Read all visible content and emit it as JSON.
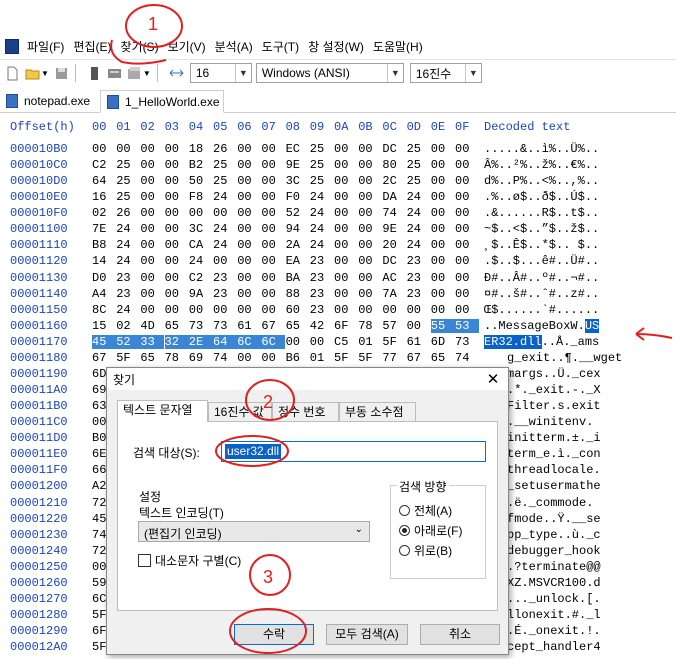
{
  "menu": [
    "파일(F)",
    "편집(E)",
    "찾기(S)",
    "보기(V)",
    "분석(A)",
    "도구(T)",
    "창 설정(W)",
    "도움말(H)"
  ],
  "toolbar": {
    "columns": "16",
    "encoding": "Windows (ANSI)",
    "base": "16진수"
  },
  "tabs": [
    "notepad.exe",
    "1_HelloWorld.exe"
  ],
  "hex_header": {
    "offset": "Offset(h)",
    "columns": [
      "00",
      "01",
      "02",
      "03",
      "04",
      "05",
      "06",
      "07",
      "08",
      "09",
      "0A",
      "0B",
      "0C",
      "0D",
      "0E",
      "0F"
    ],
    "decoded": "Decoded text"
  },
  "rows": [
    {
      "off": "000010B0",
      "bytes": [
        "00",
        "00",
        "00",
        "00",
        "18",
        "26",
        "00",
        "00",
        "EC",
        "25",
        "00",
        "00",
        "DC",
        "25",
        "00",
        "00"
      ],
      "text": ".....&..ì%..Ü%.."
    },
    {
      "off": "000010C0",
      "bytes": [
        "C2",
        "25",
        "00",
        "00",
        "B2",
        "25",
        "00",
        "00",
        "9E",
        "25",
        "00",
        "00",
        "80",
        "25",
        "00",
        "00"
      ],
      "text": "Â%..²%..ž%..€%.."
    },
    {
      "off": "000010D0",
      "bytes": [
        "64",
        "25",
        "00",
        "00",
        "50",
        "25",
        "00",
        "00",
        "3C",
        "25",
        "00",
        "00",
        "2C",
        "25",
        "00",
        "00"
      ],
      "text": "d%..P%..<%..,%.."
    },
    {
      "off": "000010E0",
      "bytes": [
        "16",
        "25",
        "00",
        "00",
        "F8",
        "24",
        "00",
        "00",
        "F0",
        "24",
        "00",
        "00",
        "DA",
        "24",
        "00",
        "00"
      ],
      "text": ".%..ø$..ð$..Ú$.."
    },
    {
      "off": "000010F0",
      "bytes": [
        "02",
        "26",
        "00",
        "00",
        "00",
        "00",
        "00",
        "00",
        "52",
        "24",
        "00",
        "00",
        "74",
        "24",
        "00",
        "00"
      ],
      "text": ".&......R$..t$.."
    },
    {
      "off": "00001100",
      "bytes": [
        "7E",
        "24",
        "00",
        "00",
        "3C",
        "24",
        "00",
        "00",
        "94",
        "24",
        "00",
        "00",
        "9E",
        "24",
        "00",
        "00"
      ],
      "text": "~$..<$..”$..ž$.."
    },
    {
      "off": "00001110",
      "bytes": [
        "B8",
        "24",
        "00",
        "00",
        "CA",
        "24",
        "00",
        "00",
        "2A",
        "24",
        "00",
        "00",
        "20",
        "24",
        "00",
        "00"
      ],
      "text": "¸$..Ê$..*$.. $.."
    },
    {
      "off": "00001120",
      "bytes": [
        "14",
        "24",
        "00",
        "00",
        "24",
        "00",
        "00",
        "00",
        "EA",
        "23",
        "00",
        "00",
        "DC",
        "23",
        "00",
        "00"
      ],
      "text": ".$..$...ê#..Ü#.."
    },
    {
      "off": "00001130",
      "bytes": [
        "D0",
        "23",
        "00",
        "00",
        "C2",
        "23",
        "00",
        "00",
        "BA",
        "23",
        "00",
        "00",
        "AC",
        "23",
        "00",
        "00"
      ],
      "text": "Ð#..Â#..º#..¬#.."
    },
    {
      "off": "00001140",
      "bytes": [
        "A4",
        "23",
        "00",
        "00",
        "9A",
        "23",
        "00",
        "00",
        "88",
        "23",
        "00",
        "00",
        "7A",
        "23",
        "00",
        "00"
      ],
      "text": "¤#..š#..ˆ#..z#.."
    },
    {
      "off": "00001150",
      "bytes": [
        "8C",
        "24",
        "00",
        "00",
        "00",
        "00",
        "00",
        "00",
        "60",
        "23",
        "00",
        "00",
        "00",
        "00",
        "00",
        "00"
      ],
      "text": "Œ$......`#......"
    },
    {
      "off": "00001160",
      "bytes": [
        "15",
        "02",
        "4D",
        "65",
        "73",
        "73",
        "61",
        "67",
        "65",
        "42",
        "6F",
        "78",
        "57",
        "00",
        "55",
        "53"
      ],
      "text": "..MessageBoxW.US",
      "sel_from": 14
    },
    {
      "off": "00001170",
      "bytes": [
        "45",
        "52",
        "33",
        "32",
        "2E",
        "64",
        "6C",
        "6C",
        "00",
        "00",
        "C5",
        "01",
        "5F",
        "61",
        "6D",
        "73"
      ],
      "text": "ER32.dll..Å._ams",
      "sel_to": 7
    },
    {
      "off": "00001180",
      "bytes": [
        "67",
        "5F",
        "65",
        "78",
        "69",
        "74",
        "00",
        "00",
        "B6",
        "01",
        "5F",
        "5F",
        "77",
        "67",
        "65",
        "74"
      ],
      "text": "g_exit..¶.__wget"
    },
    {
      "off": "00001190",
      "bytes": [
        "6D"
      ],
      "text": "margs..Ü._cex"
    },
    {
      "off": "000011A0",
      "bytes": [
        "69"
      ],
      "text": ".*._exit.-._X"
    },
    {
      "off": "000011B0",
      "bytes": [
        "63"
      ],
      "text": "Filter.s.exit"
    },
    {
      "off": "000011C0",
      "bytes": [
        "00"
      ],
      "text": ".__winitenv."
    },
    {
      "off": "000011D0",
      "bytes": [
        "B0"
      ],
      "text": "initterm.±._i"
    },
    {
      "off": "000011E0",
      "bytes": [
        "6E"
      ],
      "text": "term_e.ì._con"
    },
    {
      "off": "000011F0",
      "bytes": [
        "66"
      ],
      "text": "threadlocale."
    },
    {
      "off": "00001200",
      "bytes": [
        "A2"
      ],
      "text": "_setusermathe"
    },
    {
      "off": "00001210",
      "bytes": [
        "72"
      ],
      "text": ".ë._commode."
    },
    {
      "off": "00001220",
      "bytes": [
        "45"
      ],
      "text": "fmode..Ÿ.__se"
    },
    {
      "off": "00001230",
      "bytes": [
        "74"
      ],
      "text": "pp_type..ù._c"
    },
    {
      "off": "00001240",
      "bytes": [
        "72"
      ],
      "text": "debugger_hook"
    },
    {
      "off": "00001250",
      "bytes": [
        "00"
      ],
      "text": ".?terminate@@"
    },
    {
      "off": "00001260",
      "bytes": [
        "59"
      ],
      "text": "XZ.MSVCR100.d"
    },
    {
      "off": "00001270",
      "bytes": [
        "6C"
      ],
      "text": "..._unlock.[."
    },
    {
      "off": "00001280",
      "bytes": [
        "5F"
      ],
      "text": "llonexit.#._l"
    },
    {
      "off": "00001290",
      "bytes": [
        "6F"
      ],
      "text": ".É._onexit.!."
    },
    {
      "off": "000012A0",
      "bytes": [
        "5F"
      ],
      "text": "cept_handler4"
    }
  ],
  "dialog": {
    "title": "찾기",
    "close": "✕",
    "tabs": [
      "텍스트 문자열",
      "16진수 값",
      "정수 번호",
      "부동 소수점"
    ],
    "search_label": "검색 대상(S):",
    "search_value": "user32.dll",
    "settings_label": "설정",
    "encoding_label": "텍스트 인코딩(T)",
    "encoding_value": "(편집기 인코딩)",
    "case_label": "대소문자 구별(C)",
    "direction_label": "검색 방향",
    "dir_all": "전체(A)",
    "dir_down": "아래로(F)",
    "dir_up": "위로(B)",
    "btn_ok": "수락",
    "btn_findall": "모두 검색(A)",
    "btn_cancel": "취소"
  },
  "annotations": [
    "1",
    "2",
    "3"
  ],
  "colors": {
    "offset_blue": "#1a44c6",
    "selection": "#0a62c9",
    "annotation_red": "#e02020"
  }
}
